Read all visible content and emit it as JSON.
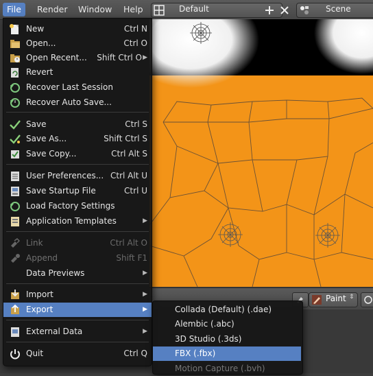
{
  "header": {
    "menus": [
      "File",
      "Render",
      "Window",
      "Help"
    ],
    "screen_layout": "Default",
    "scene": "Scene"
  },
  "editor_header": {
    "mode": "Paint"
  },
  "file_menu": {
    "items": [
      {
        "label": "New",
        "shortcut": "Ctrl N",
        "icon": "new-file-icon"
      },
      {
        "label": "Open...",
        "shortcut": "Ctrl O",
        "icon": "open-folder-icon"
      },
      {
        "label": "Open Recent...",
        "shortcut": "Shift Ctrl O",
        "icon": "open-recent-icon",
        "submenu": true
      },
      {
        "label": "Revert",
        "shortcut": "",
        "icon": "revert-icon"
      },
      {
        "label": "Recover Last Session",
        "shortcut": "",
        "icon": "recover-last-icon"
      },
      {
        "label": "Recover Auto Save...",
        "shortcut": "",
        "icon": "recover-auto-icon"
      },
      {
        "label": "Save",
        "shortcut": "Ctrl S",
        "icon": "save-checkmark-icon"
      },
      {
        "label": "Save As...",
        "shortcut": "Shift Ctrl S",
        "icon": "save-as-checkmark-icon"
      },
      {
        "label": "Save Copy...",
        "shortcut": "Ctrl Alt S",
        "icon": "save-copy-icon"
      },
      {
        "label": "User Preferences...",
        "shortcut": "Ctrl Alt U",
        "icon": "preferences-icon"
      },
      {
        "label": "Save Startup File",
        "shortcut": "Ctrl U",
        "icon": "save-startup-icon"
      },
      {
        "label": "Load Factory Settings",
        "shortcut": "",
        "icon": "factory-settings-icon"
      },
      {
        "label": "Application Templates",
        "shortcut": "",
        "icon": "templates-icon",
        "submenu": true
      },
      {
        "label": "Link",
        "shortcut": "Ctrl Alt O",
        "icon": "link-icon",
        "disabled": true
      },
      {
        "label": "Append",
        "shortcut": "Shift F1",
        "icon": "append-icon",
        "disabled": true
      },
      {
        "label": "Data Previews",
        "shortcut": "",
        "icon": "",
        "submenu": true
      },
      {
        "label": "Import",
        "shortcut": "",
        "icon": "import-icon",
        "submenu": true
      },
      {
        "label": "Export",
        "shortcut": "",
        "icon": "export-icon",
        "submenu": true,
        "highlighted": true
      },
      {
        "label": "External Data",
        "shortcut": "",
        "icon": "external-data-icon",
        "submenu": true
      },
      {
        "label": "Quit",
        "shortcut": "Ctrl Q",
        "icon": "power-icon"
      }
    ]
  },
  "export_menu": {
    "items": [
      {
        "label": "Collada (Default) (.dae)"
      },
      {
        "label": "Alembic (.abc)"
      },
      {
        "label": "3D Studio (.3ds)"
      },
      {
        "label": "FBX (.fbx)",
        "highlighted": true
      },
      {
        "label": "Motion Capture (.bvh)"
      }
    ]
  },
  "colors": {
    "accent": "#5680c2",
    "viewport_orange": "#f39418",
    "menu_bg": "#161616"
  }
}
